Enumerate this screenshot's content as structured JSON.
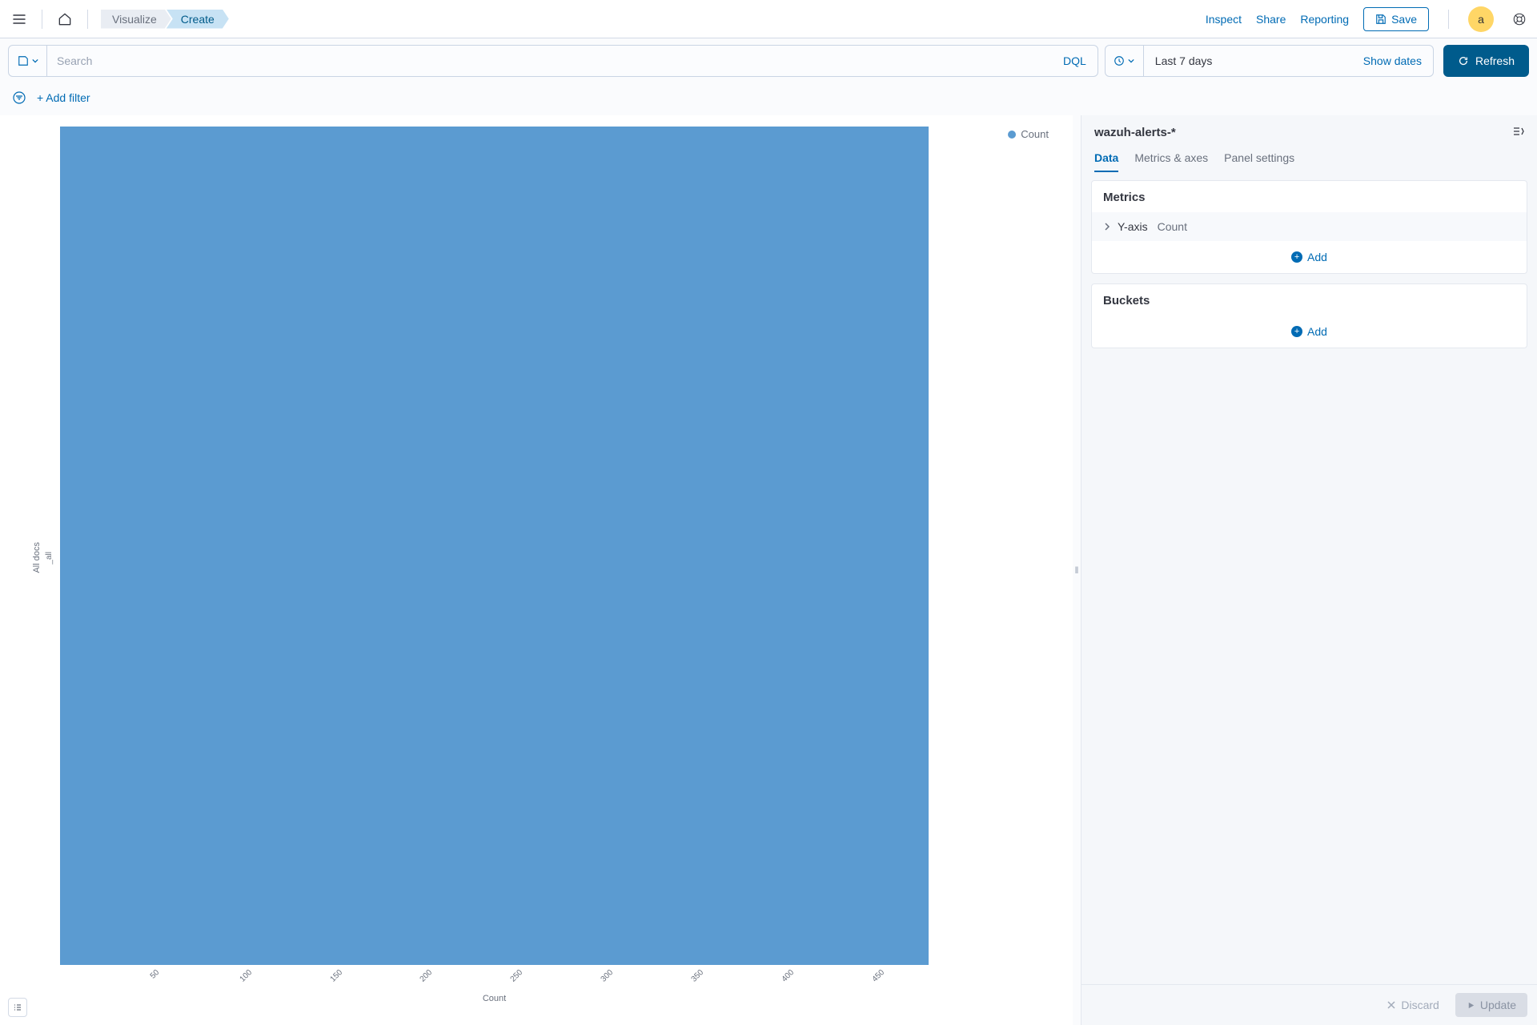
{
  "header": {
    "breadcrumbs": [
      "Visualize",
      "Create"
    ],
    "links": {
      "inspect": "Inspect",
      "share": "Share",
      "reporting": "Reporting"
    },
    "save": "Save",
    "avatar_initial": "a"
  },
  "query": {
    "search_placeholder": "Search",
    "dql": "DQL",
    "time_range": "Last 7 days",
    "show_dates": "Show dates",
    "refresh": "Refresh",
    "add_filter": "+ Add filter"
  },
  "legend": {
    "series": "Count"
  },
  "chart_data": {
    "type": "bar",
    "orientation": "horizontal",
    "categories": [
      "_all"
    ],
    "values": [
      480
    ],
    "xlabel": "Count",
    "ylabel": "All docs",
    "xticks": [
      50,
      100,
      150,
      200,
      250,
      300,
      350,
      400,
      450
    ],
    "xlim": [
      0,
      480
    ],
    "series_name": "Count",
    "color": "#5b9bd1"
  },
  "sidebar": {
    "pattern": "wazuh-alerts-*",
    "tabs": [
      "Data",
      "Metrics & axes",
      "Panel settings"
    ],
    "active_tab": 0,
    "metrics": {
      "title": "Metrics",
      "items": [
        {
          "axis": "Y-axis",
          "agg": "Count"
        }
      ],
      "add": "Add"
    },
    "buckets": {
      "title": "Buckets",
      "add": "Add"
    },
    "footer": {
      "discard": "Discard",
      "update": "Update"
    }
  }
}
